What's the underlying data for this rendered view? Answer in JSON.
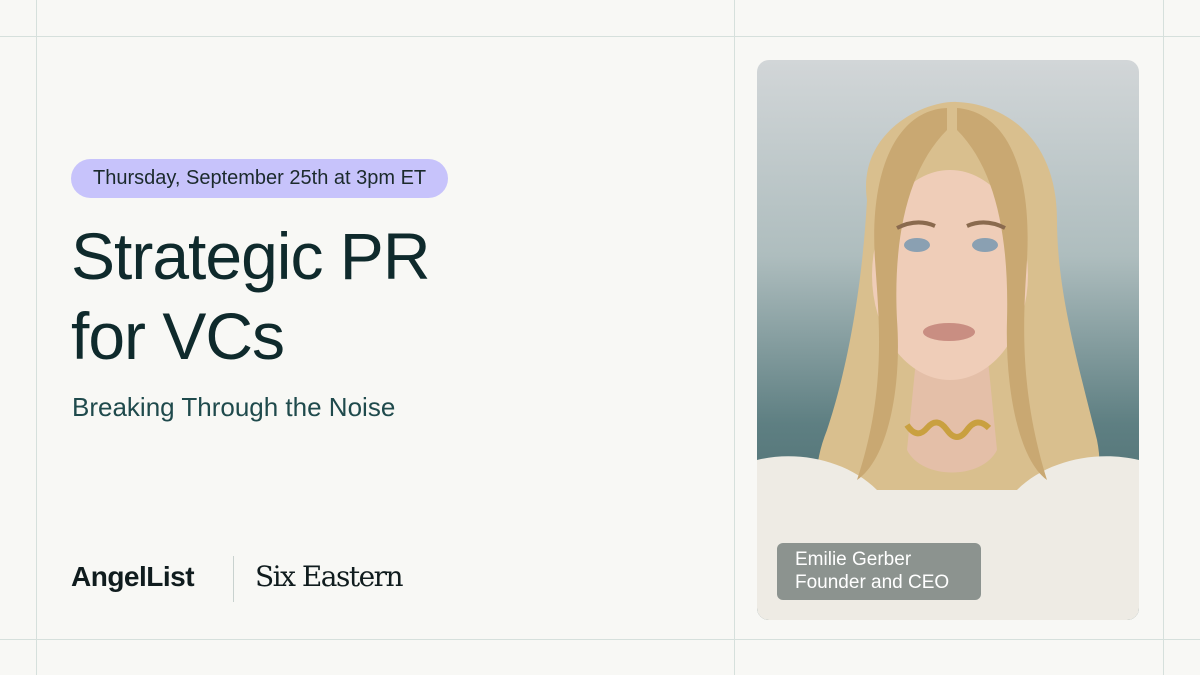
{
  "event": {
    "date_label": "Thursday, September 25th at 3pm ET",
    "title_line1": "Strategic PR",
    "title_line2": "for VCs",
    "subtitle": "Breaking Through the Noise"
  },
  "logos": {
    "angellist": "AngelList",
    "sixeastern": "Six Eastern"
  },
  "speaker": {
    "name": "Emilie Gerber",
    "role": "Founder and CEO"
  },
  "colors": {
    "background": "#f8f8f5",
    "date_pill": "#c7c3fb",
    "title": "#0f2a2c",
    "subtitle": "#1f4a4c",
    "gridline": "#d6e0dc"
  }
}
